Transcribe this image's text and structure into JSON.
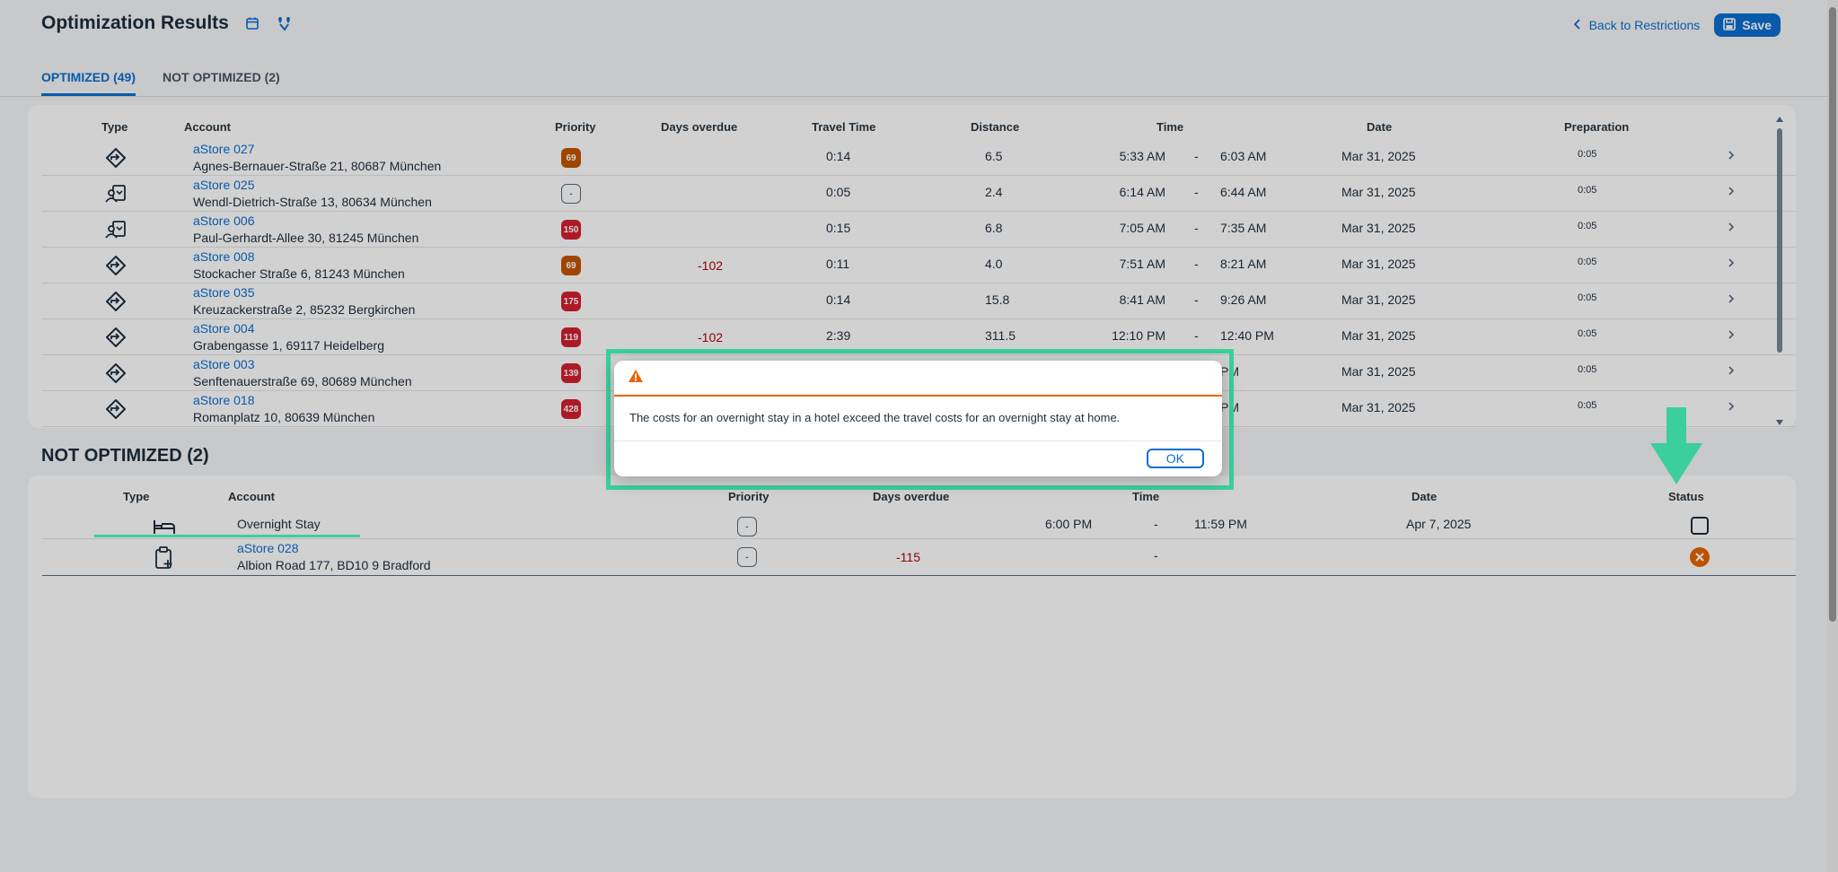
{
  "header": {
    "title": "Optimization Results",
    "back_label": "Back to Restrictions",
    "save_label": "Save"
  },
  "tabs": [
    {
      "label": "OPTIMIZED (49)",
      "active": true
    },
    {
      "label": "NOT OPTIMIZED (2)",
      "active": false
    }
  ],
  "optimized": {
    "columns": [
      "Type",
      "Account",
      "Priority",
      "Days overdue",
      "Travel Time",
      "Distance",
      "Time",
      "Date",
      "Preparation"
    ],
    "rows": [
      {
        "icon": "visit-icon",
        "account": "aStore 027",
        "address": "Agnes-Bernauer-Straße 21, 80687 München",
        "priority": "69",
        "prio_color": "#c35500",
        "overdue": "",
        "travel": "0:14",
        "distance": "6.5",
        "start": "5:33 AM",
        "dash": "-",
        "end": "6:03 AM",
        "date": "Mar 31, 2025",
        "prep": "0:05"
      },
      {
        "icon": "contact-icon",
        "account": "aStore 025",
        "address": "Wendl-Dietrich-Straße 13, 80634 München",
        "priority": "-",
        "prio_color": "neutral",
        "overdue": "",
        "travel": "0:05",
        "distance": "2.4",
        "start": "6:14 AM",
        "dash": "-",
        "end": "6:44 AM",
        "date": "Mar 31, 2025",
        "prep": "0:05"
      },
      {
        "icon": "contact-icon",
        "account": "aStore 006",
        "address": "Paul-Gerhardt-Allee 30, 81245 München",
        "priority": "150",
        "prio_color": "#d32030",
        "overdue": "",
        "travel": "0:15",
        "distance": "6.8",
        "start": "7:05 AM",
        "dash": "-",
        "end": "7:35 AM",
        "date": "Mar 31, 2025",
        "prep": "0:05"
      },
      {
        "icon": "visit-icon",
        "account": "aStore 008",
        "address": "Stockacher Straße 6, 81243 München",
        "priority": "69",
        "prio_color": "#c35500",
        "overdue": "-102",
        "travel": "0:11",
        "distance": "4.0",
        "start": "7:51 AM",
        "dash": "-",
        "end": "8:21 AM",
        "date": "Mar 31, 2025",
        "prep": "0:05"
      },
      {
        "icon": "visit-icon",
        "account": "aStore 035",
        "address": "Kreuzackerstraße 2, 85232 Bergkirchen",
        "priority": "175",
        "prio_color": "#d32030",
        "overdue": "",
        "travel": "0:14",
        "distance": "15.8",
        "start": "8:41 AM",
        "dash": "-",
        "end": "9:26 AM",
        "date": "Mar 31, 2025",
        "prep": "0:05"
      },
      {
        "icon": "visit-icon",
        "account": "aStore 004",
        "address": "Grabengasse 1, 69117 Heidelberg",
        "priority": "119",
        "prio_color": "#d32030",
        "overdue": "-102",
        "travel": "2:39",
        "distance": "311.5",
        "start": "12:10 PM",
        "dash": "-",
        "end": "12:40 PM",
        "date": "Mar 31, 2025",
        "prep": "0:05"
      },
      {
        "icon": "visit-icon",
        "account": "aStore 003",
        "address": "Senftenauerstraße 69, 80689 München",
        "priority": "139",
        "prio_color": "#d32030",
        "overdue": "",
        "travel": "",
        "distance": "",
        "start": "",
        "dash": "",
        "end": "PM",
        "date": "Mar 31, 2025",
        "prep": "0:05"
      },
      {
        "icon": "visit-icon",
        "account": "aStore 018",
        "address": "Romanplatz 10, 80639 München",
        "priority": "428",
        "prio_color": "#d32030",
        "overdue": "",
        "travel": "",
        "distance": "",
        "start": "",
        "dash": "",
        "end": "PM",
        "date": "Mar 31, 2025",
        "prep": "0:05"
      }
    ]
  },
  "not_optimized": {
    "title": "NOT OPTIMIZED (2)",
    "columns": [
      "Type",
      "Account",
      "Priority",
      "Days overdue",
      "Time",
      "Date",
      "Status"
    ],
    "rows": [
      {
        "icon": "bed-icon",
        "account": "Overnight Stay",
        "address": "",
        "priority": "-",
        "overdue": "",
        "start": "6:00 PM",
        "dash": "-",
        "end": "11:59 PM",
        "date": "Apr 7, 2025",
        "status": "checkbox"
      },
      {
        "icon": "clipboard-add-icon",
        "account": "aStore 028",
        "address": "Albion Road 177, BD10 9 Bradford",
        "priority": "-",
        "overdue": "-115",
        "start": "",
        "dash": "-",
        "end": "",
        "date": "",
        "status": "error"
      }
    ]
  },
  "dialog": {
    "message": "The costs for an overnight stay in a hotel exceed the travel costs for an overnight stay at home.",
    "ok_label": "OK"
  },
  "colors": {
    "accent": "#0a6ed1",
    "highlight": "#3ccf9e",
    "warning": "#e76500",
    "error": "#d32030"
  }
}
